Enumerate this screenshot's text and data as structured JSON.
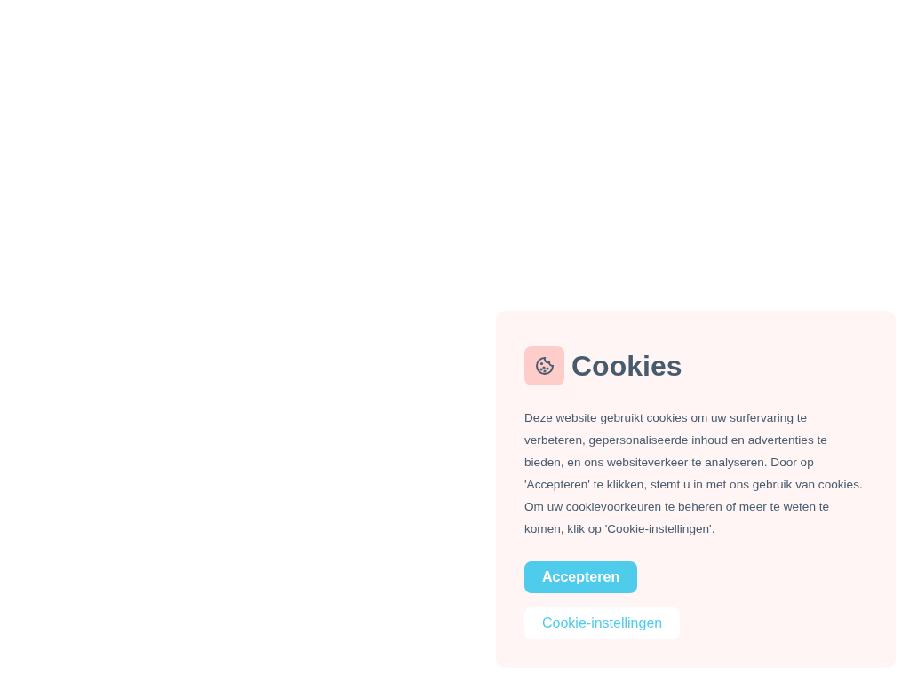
{
  "banner": {
    "title": "Cookies",
    "text": "Deze website gebruikt cookies om uw surfervaring te verbeteren, gepersonaliseerde inhoud en advertenties te bieden, en ons websiteverkeer te analyseren. Door op 'Accepteren' te klikken, stemt u in met ons gebruik van cookies. Om uw cookievoorkeuren te beheren of meer te weten te komen, klik op 'Cookie-instellingen'.",
    "buttons": [
      {
        "label": "Accepteren",
        "kind": "primary"
      },
      {
        "label": "Cookie-instellingen",
        "kind": "secondary"
      }
    ]
  }
}
